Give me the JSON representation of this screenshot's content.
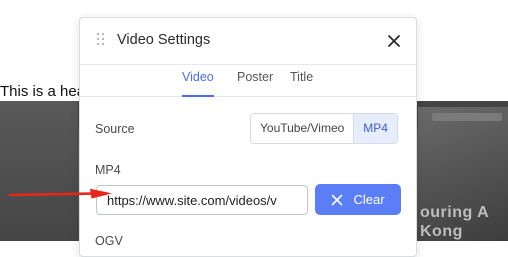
{
  "page": {
    "heading_text": "This is a hea",
    "overlay_line1": "ouring A",
    "overlay_line2": "Kong"
  },
  "modal": {
    "title": "Video Settings",
    "drag_icon": "drag-handle-icon",
    "close_icon": "close-icon",
    "tabs": [
      {
        "label": "Video",
        "active": true
      },
      {
        "label": "Poster",
        "active": false
      },
      {
        "label": "Title",
        "active": false
      }
    ],
    "source": {
      "label": "Source",
      "options": [
        {
          "label": "YouTube/Vimeo",
          "active": false
        },
        {
          "label": "MP4",
          "active": true
        }
      ]
    },
    "mp4": {
      "label": "MP4",
      "url_value": "https://www.site.com/videos/v",
      "clear_label": "Clear",
      "clear_icon": "x-icon"
    },
    "ogv": {
      "label": "OGV"
    }
  },
  "annotation": {
    "arrow_color": "#e8261b"
  },
  "colors": {
    "accent": "#4a6cf7",
    "clear_button": "#5b7ef7",
    "active_segment_bg": "#e6edfd"
  }
}
